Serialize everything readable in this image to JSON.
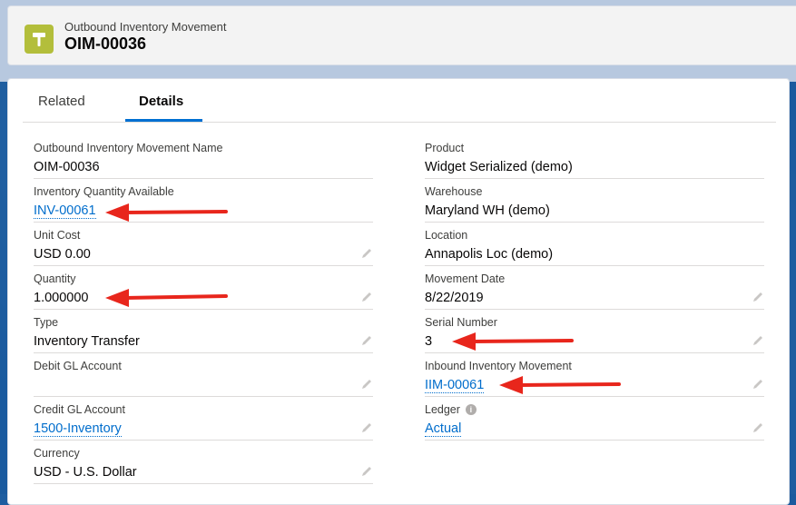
{
  "header": {
    "object_type": "Outbound Inventory Movement",
    "record_name": "OIM-00036",
    "icon": "hammer-icon",
    "icon_color": "#b3be3b"
  },
  "tabs": [
    {
      "label": "Related",
      "active": false
    },
    {
      "label": "Details",
      "active": true
    }
  ],
  "left_fields": [
    {
      "label": "Outbound Inventory Movement Name",
      "value": "OIM-00036"
    },
    {
      "label": "Inventory Quantity Available",
      "value": "INV-00061"
    },
    {
      "label": "Unit Cost",
      "value": "USD 0.00"
    },
    {
      "label": "Quantity",
      "value": "1.000000"
    },
    {
      "label": "Type",
      "value": "Inventory Transfer"
    },
    {
      "label": "Debit GL Account",
      "value": ""
    },
    {
      "label": "Credit GL Account",
      "value": "1500-Inventory"
    },
    {
      "label": "Currency",
      "value": "USD - U.S. Dollar"
    }
  ],
  "right_fields": [
    {
      "label": "Product",
      "value": "Widget Serialized (demo)"
    },
    {
      "label": "Warehouse",
      "value": "Maryland WH (demo)"
    },
    {
      "label": "Location",
      "value": "Annapolis Loc (demo)"
    },
    {
      "label": "Movement Date",
      "value": "8/22/2019"
    },
    {
      "label": "Serial Number",
      "value": "3"
    },
    {
      "label": "Inbound Inventory Movement",
      "value": "IIM-00061"
    },
    {
      "label": "Ledger",
      "value": "Actual"
    }
  ],
  "colors": {
    "link": "#006dcc",
    "tab_active_underline": "#0070d2",
    "annotation_arrow": "#e8261c"
  }
}
